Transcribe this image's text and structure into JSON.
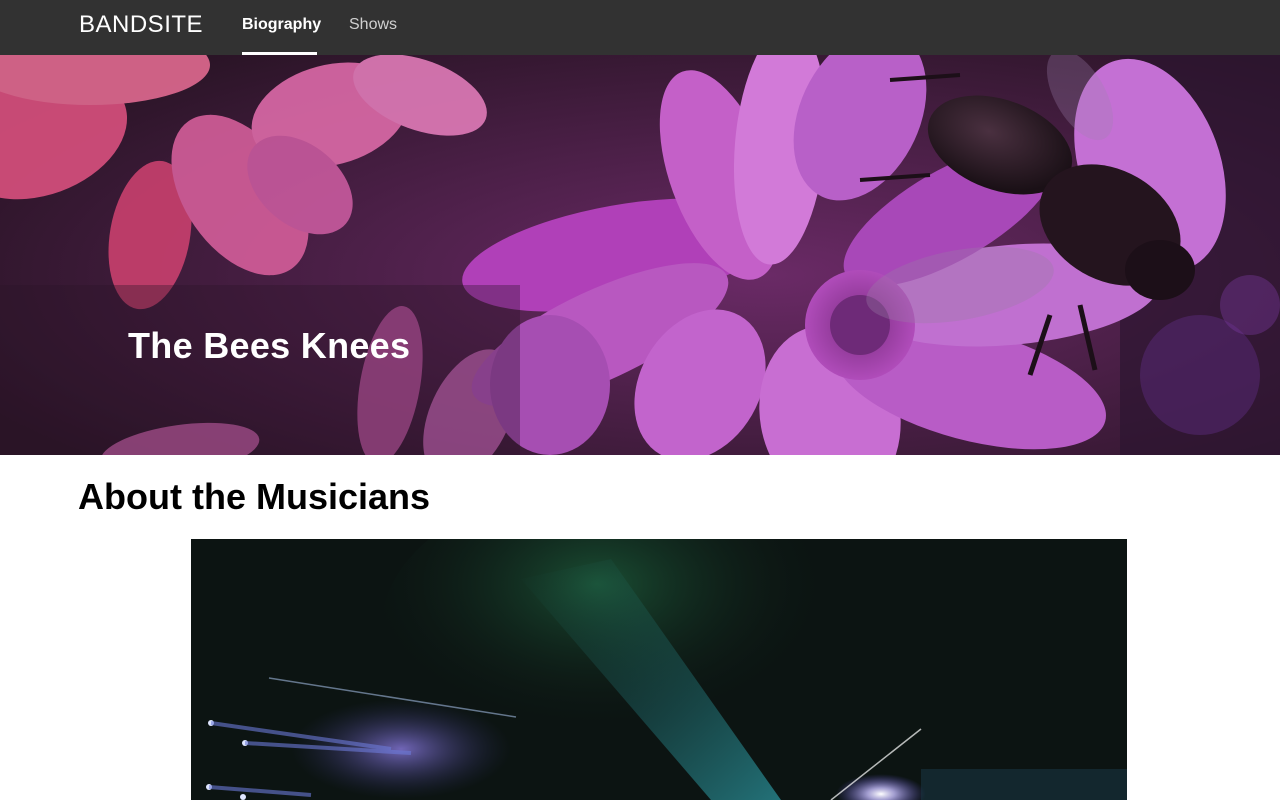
{
  "nav": {
    "brand": "BANDSITE",
    "links": [
      {
        "label": "Biography",
        "active": true
      },
      {
        "label": "Shows",
        "active": false
      }
    ]
  },
  "hero": {
    "title": "The Bees Knees"
  },
  "about": {
    "heading": "About the Musicians"
  },
  "colors": {
    "nav_bg": "#323232",
    "hero_tint": "#b03cb8",
    "concert_bg": "#0c1412"
  }
}
